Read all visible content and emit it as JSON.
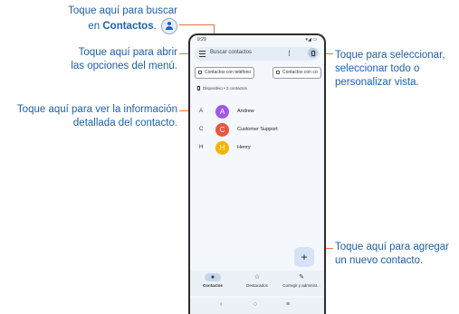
{
  "callouts": {
    "search_1": "Toque aquí para buscar",
    "search_2a": "en ",
    "search_2b": "Contactos",
    "search_2c": ".",
    "menu_1": "Toque aquí para abrir",
    "menu_2": "las opciones del menú.",
    "detail_1": "Toque aquí para ver la información",
    "detail_2": "detallada del contacto.",
    "select_1": "Toque para seleccionar,",
    "select_2": "seleccionar todo o",
    "select_3": "personalizar vista.",
    "add_1": "Toque aquí para agregar",
    "add_2": "un nuevo contacto."
  },
  "phone": {
    "status_time": "9:29",
    "status_right": "▾◢ ▭",
    "search_placeholder": "Buscar contactos",
    "more_symbol": "⋮",
    "chips": [
      "Contactos con teléfono",
      "Contactos con co"
    ],
    "device_label": "Dispositivo • 3 contactos",
    "contacts": [
      {
        "letter": "A",
        "initial": "A",
        "name": "Andrew",
        "color": "#a157e6"
      },
      {
        "letter": "C",
        "initial": "C",
        "name": "Customer Support",
        "color": "#e8563f"
      },
      {
        "letter": "H",
        "initial": "H",
        "name": "Henry",
        "color": "#f4b400"
      }
    ],
    "fab_symbol": "+",
    "nav": [
      {
        "icon": "person-icon",
        "glyph": "●",
        "label": "Contactos"
      },
      {
        "icon": "star-box-icon",
        "glyph": "☆",
        "label": "Destacados"
      },
      {
        "icon": "wrench-icon",
        "glyph": "✎",
        "label": "Corregir y administ..."
      }
    ],
    "sysnav": [
      "‹",
      "○",
      "≡"
    ]
  },
  "colors": {
    "callout_text": "#1f5fa8",
    "leader_line": "#e8743b"
  }
}
